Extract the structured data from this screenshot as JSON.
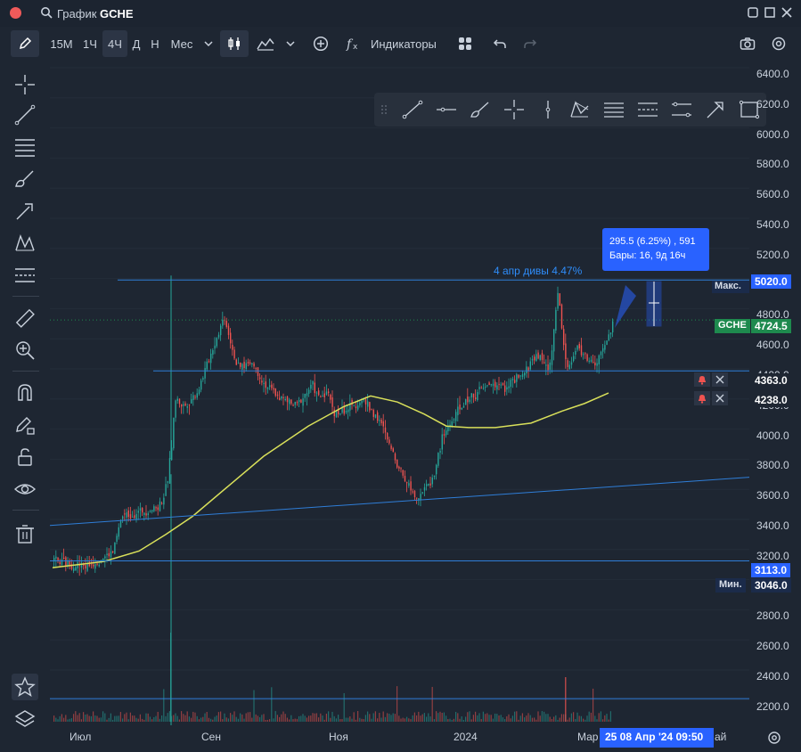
{
  "window": {
    "title_label": "График",
    "ticker": "GCHE"
  },
  "toolbar": {
    "timeframes": [
      "15M",
      "1Ч",
      "4Ч",
      "Д",
      "Н",
      "Мес"
    ],
    "active_timeframe": "4Ч",
    "indicators_label": "Индикаторы"
  },
  "axis": {
    "ticks": [
      "6400.0",
      "6200.0",
      "6000.0",
      "5800.0",
      "5600.0",
      "5400.0",
      "5200.0",
      "5000.0",
      "4800.0",
      "4600.0",
      "4400.0",
      "4200.0",
      "4000.0",
      "3800.0",
      "3600.0",
      "3400.0",
      "3200.0",
      "3000.0",
      "2800.0",
      "2600.0",
      "2400.0",
      "2200.0"
    ],
    "max_price": "5020.0",
    "current_price": "4724.5",
    "current_ticker": "GCHE",
    "level_1": "4363.0",
    "level_2": "4238.0",
    "support_price": "3113.0",
    "min_price": "3046.0",
    "max_label": "Макс.",
    "min_label": "Мин."
  },
  "xaxis": {
    "labels": [
      "Июл",
      "Сен",
      "Ноя",
      "2024",
      "Мар"
    ],
    "last_partial": "ай",
    "crosshair_date": "25  08 Апр '24   09:50"
  },
  "measure": {
    "line1": "295.5 (6.25%) , 591",
    "line2": "Бары: 16, 9д 16ч"
  },
  "annotation": "4 апр  дивы 4.47%",
  "colors": {
    "accent": "#2962ff",
    "up": "#26a69a",
    "down": "#ef5350",
    "ma": "#d9e05a",
    "line": "#2f7ed8",
    "current": "#1e8a4e"
  }
}
